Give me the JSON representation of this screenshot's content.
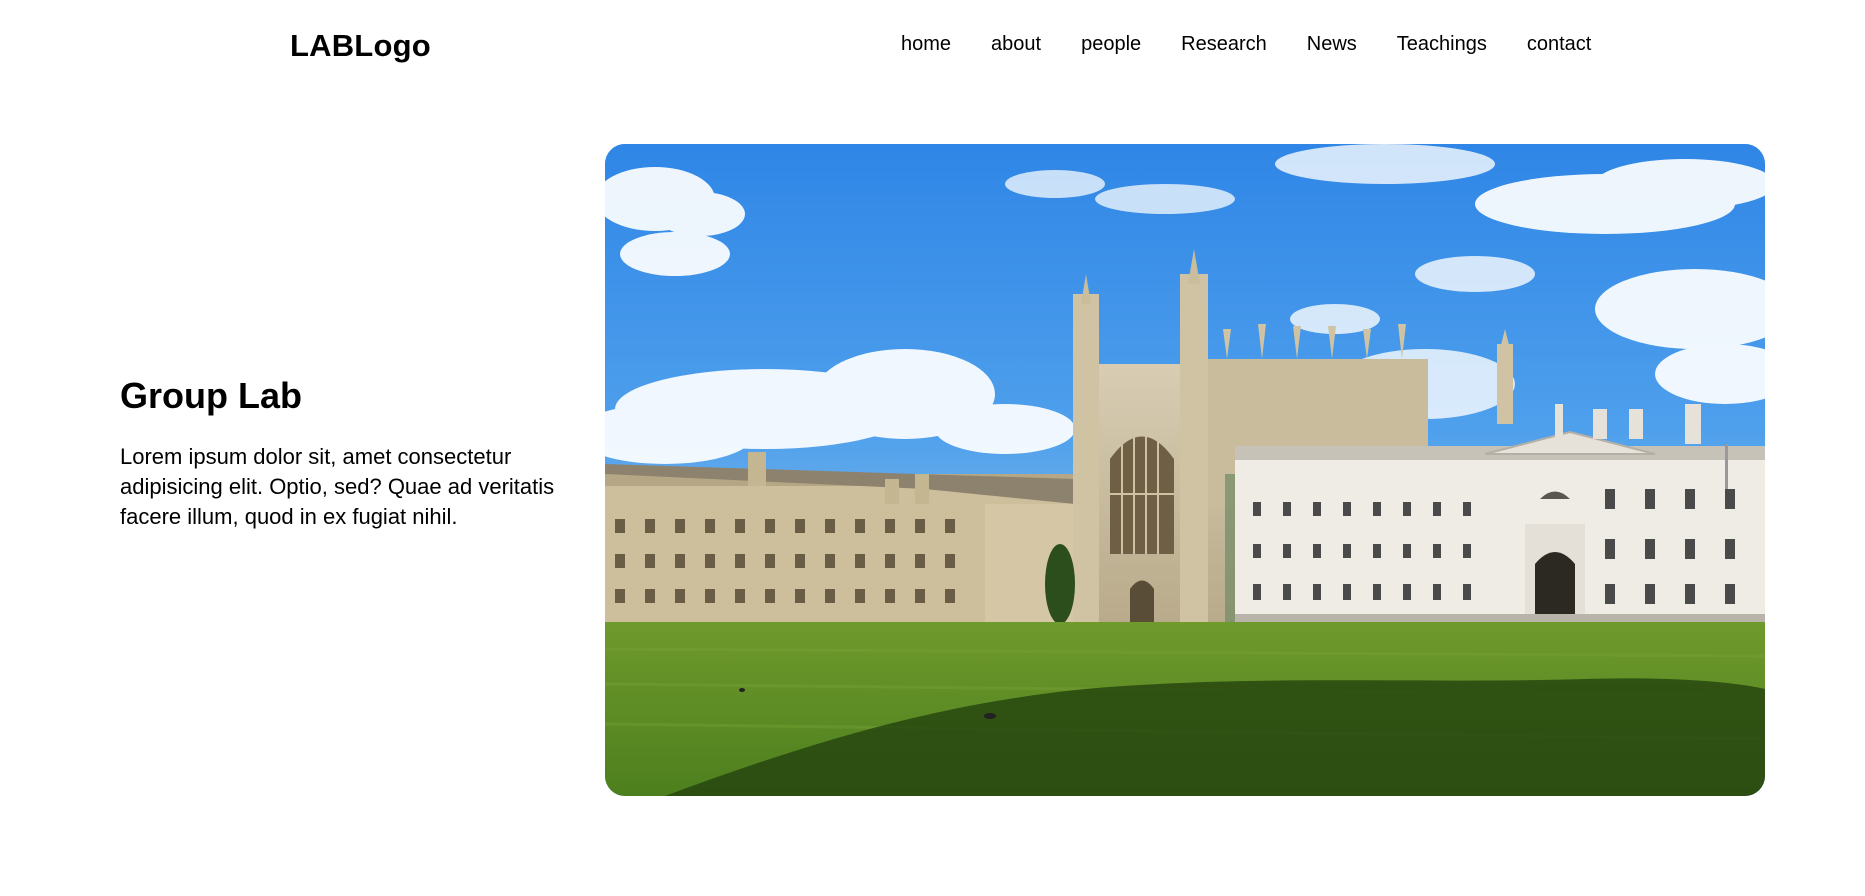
{
  "header": {
    "logo": "LABLogo",
    "nav": [
      {
        "label": "home"
      },
      {
        "label": "about"
      },
      {
        "label": "people"
      },
      {
        "label": "Research"
      },
      {
        "label": "News"
      },
      {
        "label": "Teachings"
      },
      {
        "label": "contact"
      }
    ]
  },
  "hero": {
    "title": "Group Lab",
    "description": "Lorem ipsum dolor sit, amet consectetur adipisicing elit. Optio, sed? Quae ad veritatis facere illum, quod in ex fugiat nihil.",
    "image": {
      "subject": "gothic college chapel and classical buildings across a green lawn under a blue sky with clouds"
    }
  },
  "colors": {
    "sky": "#3f8fe0",
    "grass": "#5f8f2a",
    "text": "#000000",
    "background": "#ffffff"
  }
}
